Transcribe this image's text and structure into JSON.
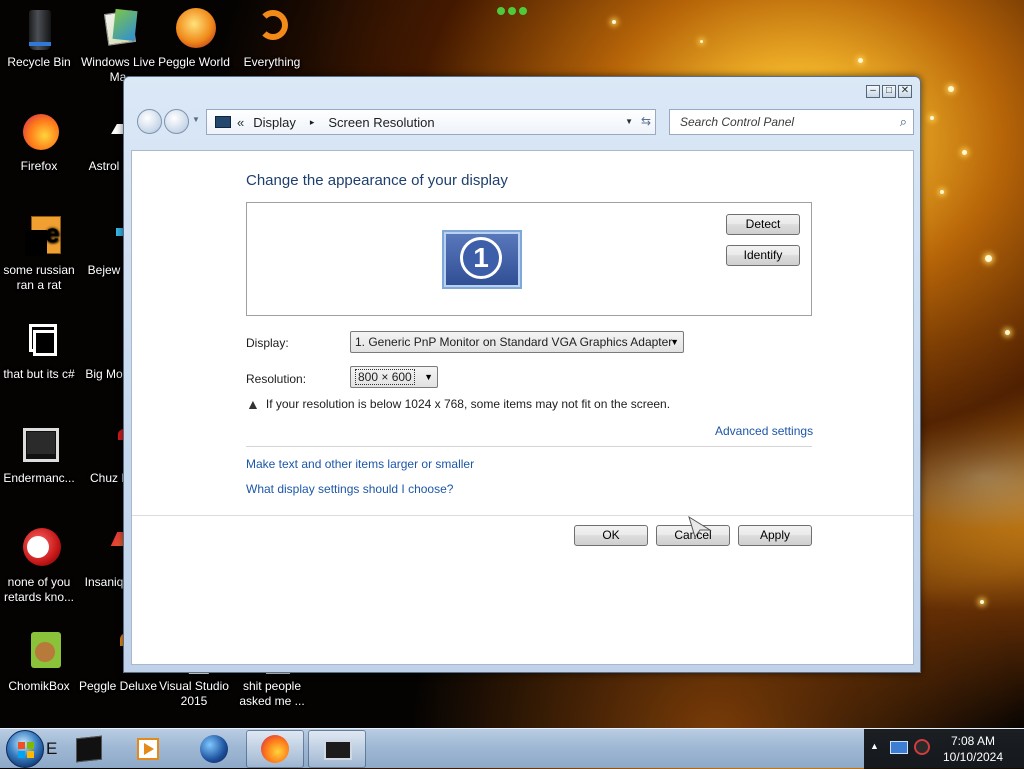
{
  "desktop": {
    "icons": [
      {
        "label": "Recycle Bin",
        "icon": "recycle-bin-icon"
      },
      {
        "label": "Windows Live Ma",
        "icon": "windows-live-icon"
      },
      {
        "label": "Peggle World",
        "icon": "peggle-icon"
      },
      {
        "label": "Everything",
        "icon": "everything-search-icon"
      },
      {
        "label": "Firefox",
        "icon": "firefox-icon"
      },
      {
        "label": "Astrol Delu",
        "icon": "game-icon"
      },
      {
        "label": "some russian ran a rat",
        "icon": "file-icon"
      },
      {
        "label": "Bejew Delu",
        "icon": "game-icon"
      },
      {
        "label": "that but its c#",
        "icon": "shortcut-icon"
      },
      {
        "label": "Big Mo Delu",
        "icon": "game-icon"
      },
      {
        "label": "Endermanc...",
        "icon": "monitor-icon"
      },
      {
        "label": "Chuz Delu",
        "icon": "game-icon"
      },
      {
        "label": "none of you retards kno...",
        "icon": "app-icon"
      },
      {
        "label": "Insaniq Delu",
        "icon": "game-icon"
      },
      {
        "label": "ChomikBox",
        "icon": "chomikbox-icon"
      },
      {
        "label": "Peggle Deluxe",
        "icon": "peggle-icon"
      },
      {
        "label": "Visual Studio 2015",
        "icon": "visual-studio-icon"
      },
      {
        "label": "shit people asked me ...",
        "icon": "firefox-icon"
      }
    ]
  },
  "window": {
    "caption_buttons": [
      "minimize",
      "maximize",
      "close"
    ],
    "breadcrumb": {
      "chevrons": "«",
      "items": [
        "Display",
        "Screen Resolution"
      ],
      "separator": "▸"
    },
    "search": {
      "placeholder": "Search Control Panel"
    },
    "heading": "Change the appearance of your display",
    "preview": {
      "monitor_number": "1",
      "detect_label": "Detect",
      "identify_label": "Identify"
    },
    "display": {
      "label": "Display:",
      "value": "1. Generic PnP Monitor on Standard VGA Graphics Adapter"
    },
    "resolution": {
      "label": "Resolution:",
      "value": "800 × 600"
    },
    "warning": "If your resolution is below 1024 x 768, some items may not fit on the screen.",
    "links": {
      "advanced": "Advanced settings",
      "larger_text": "Make text and other items larger or smaller",
      "choose": "What display settings should I choose?"
    },
    "buttons": {
      "ok": "OK",
      "cancel": "Cancel",
      "apply": "Apply"
    }
  },
  "taskbar": {
    "start_label": "E",
    "items": [
      "cmd-icon",
      "media-player-icon",
      "globe-icon",
      "firefox-icon",
      "display-settings-icon"
    ],
    "clock": {
      "time": "7:08 AM",
      "date": "10/10/2024"
    }
  }
}
